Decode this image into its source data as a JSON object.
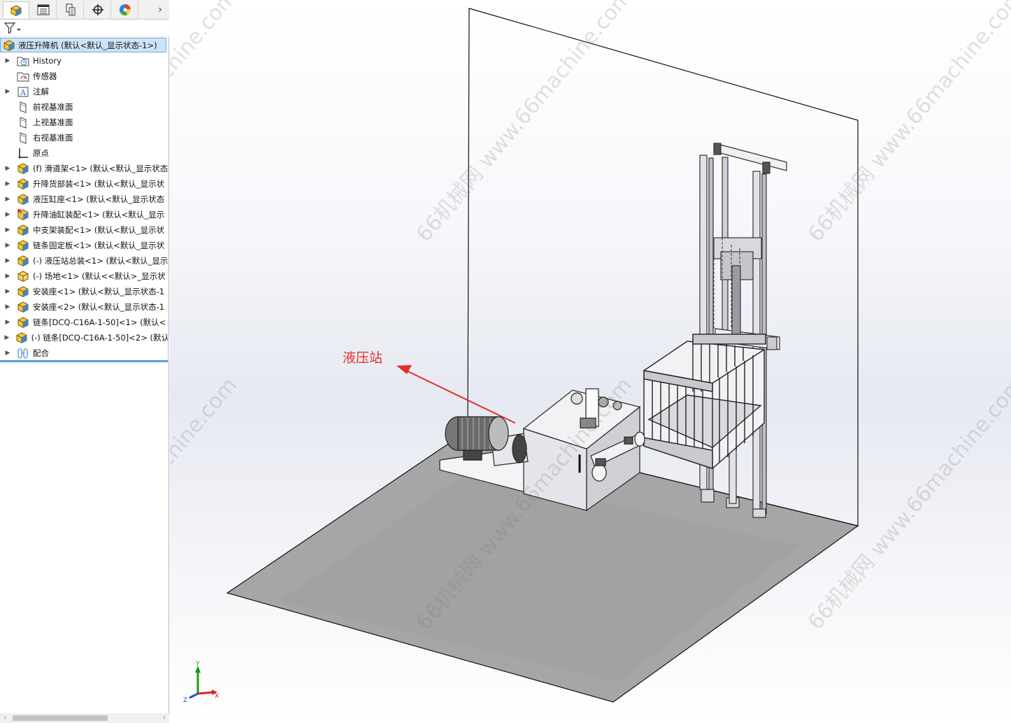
{
  "panel": {
    "tabs": [
      {
        "name": "feature-manager-tab",
        "icon": "part-cube-icon"
      },
      {
        "name": "property-manager-tab",
        "icon": "property-list-icon"
      },
      {
        "name": "configuration-manager-tab",
        "icon": "configuration-icon"
      },
      {
        "name": "dimxpert-tab",
        "icon": "crosshair-icon"
      },
      {
        "name": "display-manager-tab",
        "icon": "color-wheel-icon"
      }
    ],
    "more_arrow": "›",
    "tree": {
      "root": "液压升降机 (默认<默认_显示状态-1>)",
      "items": [
        {
          "label": "History",
          "icon": "history-folder-icon",
          "expandable": true
        },
        {
          "label": "传感器",
          "icon": "sensor-folder-icon",
          "expandable": false
        },
        {
          "label": "注解",
          "icon": "annotation-icon",
          "expandable": true
        },
        {
          "label": "前视基准面",
          "icon": "plane-icon",
          "expandable": false
        },
        {
          "label": "上视基准面",
          "icon": "plane-icon",
          "expandable": false
        },
        {
          "label": "右视基准面",
          "icon": "plane-icon",
          "expandable": false
        },
        {
          "label": "原点",
          "icon": "origin-icon",
          "expandable": false
        },
        {
          "label": "(f) 滑道架<1> (默认<默认_显示状态",
          "icon": "assembly-icon",
          "expandable": true
        },
        {
          "label": "升降货部装<1> (默认<默认_显示状",
          "icon": "assembly-icon",
          "expandable": true
        },
        {
          "label": "液压缸座<1> (默认<默认_显示状态",
          "icon": "assembly-icon",
          "expandable": true
        },
        {
          "label": "升降油缸装配<1> (默认<默认_显示",
          "icon": "assembly-linked-icon",
          "expandable": true
        },
        {
          "label": "中支架装配<1> (默认<默认_显示状",
          "icon": "assembly-icon",
          "expandable": true
        },
        {
          "label": "链条固定板<1> (默认<默认_显示状",
          "icon": "assembly-icon",
          "expandable": true
        },
        {
          "label": "(-) 液压站总装<1> (默认<默认_显示",
          "icon": "assembly-icon",
          "expandable": true
        },
        {
          "label": "(-) 场地<1> (默认<<默认>_显示状",
          "icon": "part-icon",
          "expandable": true
        },
        {
          "label": "安装座<1> (默认<默认_显示状态-1",
          "icon": "assembly-icon",
          "expandable": true
        },
        {
          "label": "安装座<2> (默认<默认_显示状态-1",
          "icon": "assembly-icon",
          "expandable": true
        },
        {
          "label": "链条[DCQ-C16A-1-50]<1> (默认<",
          "icon": "assembly-icon",
          "expandable": true
        },
        {
          "label": "(-) 链条[DCQ-C16A-1-50]<2> (默认",
          "icon": "assembly-icon",
          "expandable": true
        },
        {
          "label": "配合",
          "icon": "mates-icon",
          "expandable": true
        }
      ]
    }
  },
  "viewport": {
    "callout": {
      "text": "液压站",
      "color": "#e0302a"
    },
    "watermarks": [
      "66机械网 www.66machine.com",
      "66机械网 www.66machine.com",
      "66机械网 www.66machine.com",
      "66机械网 www.66machine.com",
      "66机械网 www.66machine.com",
      "66机械网 www.66machine.com"
    ],
    "triad": {
      "x": "X",
      "y": "Y",
      "z": "Z"
    },
    "colors": {
      "floor": "#a6a6a6",
      "x_axis": "#d22",
      "y_axis": "#1a9a1a",
      "z_axis": "#2255cc"
    }
  }
}
